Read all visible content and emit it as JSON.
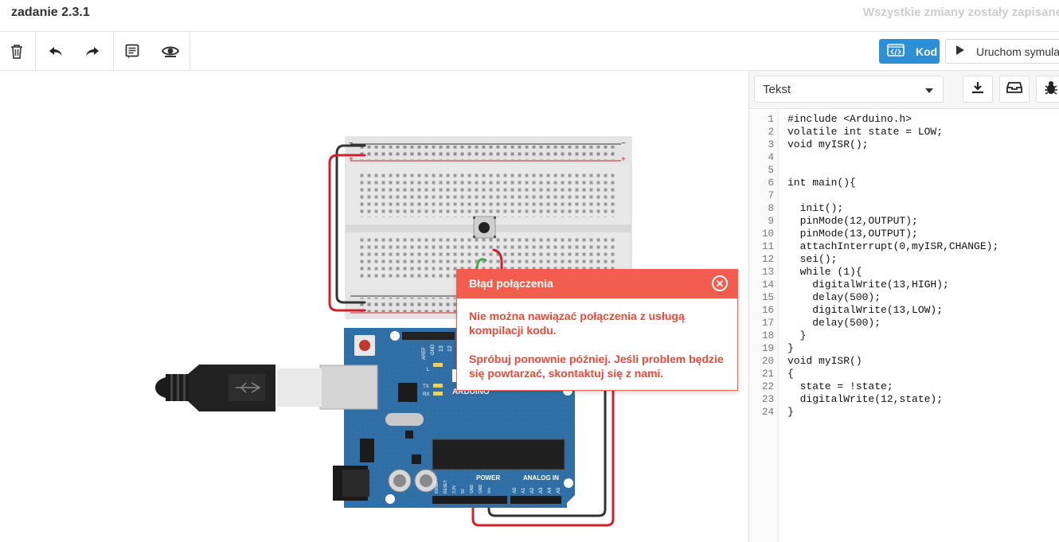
{
  "header": {
    "title": "zadanie 2.3.1",
    "saved_status": "Wszystkie zmiany zostały zapisane"
  },
  "toolbar": {
    "delete_icon": "trash-icon",
    "undo_icon": "undo-icon",
    "redo_icon": "redo-icon",
    "notes_icon": "notes-icon",
    "view_icon": "eye-icon",
    "code_button_label": "Kod",
    "simulate_button_label": "Uruchom symulację"
  },
  "code_panel": {
    "mode_select_value": "Tekst",
    "download_icon": "download-icon",
    "library_icon": "library-icon",
    "debug_icon": "bug-icon",
    "line_numbers": [
      "1",
      "2",
      "3",
      "4",
      "5",
      "6",
      "7",
      "8",
      "9",
      "10",
      "11",
      "12",
      "13",
      "14",
      "15",
      "16",
      "17",
      "18",
      "19",
      "20",
      "21",
      "22",
      "23",
      "24"
    ],
    "code_lines": [
      "#include <Arduino.h>",
      "volatile int state = LOW;",
      "void myISR();",
      "",
      "",
      "int main(){",
      "",
      "  init();",
      "  pinMode(12,OUTPUT);",
      "  pinMode(13,OUTPUT);",
      "  attachInterrupt(0,myISR,CHANGE);",
      "  sei();",
      "  while (1){",
      "    digitalWrite(13,HIGH);",
      "    delay(500);",
      "    digitalWrite(13,LOW);",
      "    delay(500);",
      "  }",
      "}",
      "void myISR()",
      "{",
      "  state = !state;",
      "  digitalWrite(12,state);",
      "}"
    ]
  },
  "error_dialog": {
    "title": "Błąd połączenia",
    "message_1": "Nie można nawiązać połączenia z usługą kompilacji kodu.",
    "message_2": "Spróbuj ponownie później. Jeśli problem będzie się powtarzać, skontaktuj się z nami."
  },
  "board": {
    "brand_label": "ARDUINO",
    "power_label": "POWER",
    "analog_label": "ANALOG IN",
    "pin_labels_top": [
      "AREF",
      "GND",
      "13",
      "12"
    ],
    "led_labels": [
      "L",
      "TX",
      "RX"
    ],
    "power_pins": [
      "IOREF",
      "RESET",
      "3.3V",
      "5V",
      "GND",
      "GND",
      "Vin"
    ],
    "analog_pins": [
      "A0",
      "A1",
      "A2",
      "A3",
      "A4",
      "A5"
    ]
  },
  "colors": {
    "accent": "#2d8fd5",
    "error": "#f25d4d",
    "arduino_blue": "#2f6fa5",
    "wire_red": "#d0202e",
    "wire_black": "#333333"
  }
}
